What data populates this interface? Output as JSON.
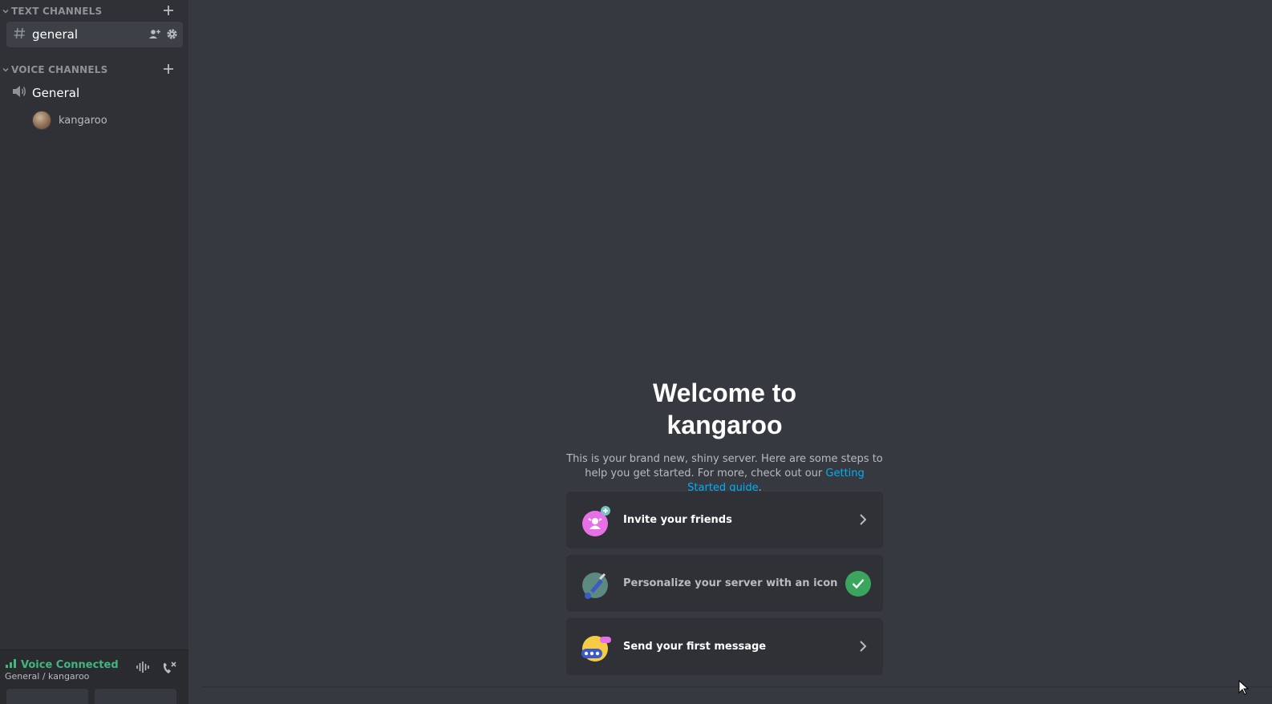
{
  "sidebar": {
    "text_category": "TEXT CHANNELS",
    "voice_category": "VOICE CHANNELS",
    "text_channels": [
      {
        "name": "general"
      }
    ],
    "voice_channels": [
      {
        "name": "General",
        "members": [
          {
            "name": "kangaroo"
          }
        ]
      }
    ]
  },
  "voice_panel": {
    "status": "Voice Connected",
    "location": "General / kangaroo"
  },
  "welcome": {
    "title_line1": "Welcome to",
    "title_line2": "kangaroo",
    "desc_main": "This is your brand new, shiny server. Here are some steps to help you get started. For more, check out our",
    "link": "Getting Started guide",
    "desc_end": "."
  },
  "cards": [
    {
      "label": "Invite your friends",
      "icon": "invite-friends-icon",
      "completed": false
    },
    {
      "label": "Personalize your server with an icon",
      "icon": "brush-icon",
      "completed": true
    },
    {
      "label": "Send your first message",
      "icon": "chat-bubble-icon",
      "completed": false
    }
  ],
  "colors": {
    "accent_link": "#00b0f4",
    "voice_connected": "#43b581",
    "check": "#3ba55d"
  }
}
